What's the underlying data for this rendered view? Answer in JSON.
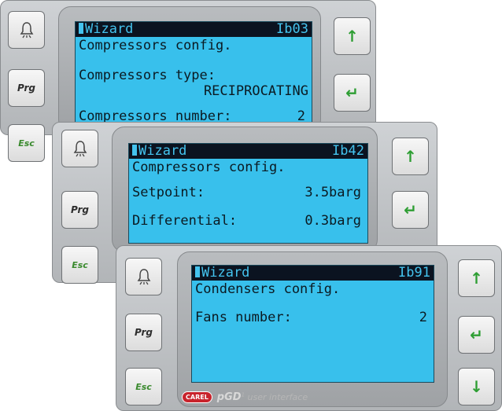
{
  "buttons": {
    "alarm_icon": "bell-icon",
    "prg": "Prg",
    "esc": "Esc",
    "up_icon": "up-arrow-icon",
    "enter_icon": "enter-icon",
    "down_icon": "down-arrow-icon"
  },
  "colors": {
    "lcd": "#38c0ec",
    "lcd_text": "#0b1a22",
    "header_bg": "#0b1320",
    "arrow": "#2e9e33",
    "esc": "#3a8a2e"
  },
  "panel1": {
    "header": "Wizard",
    "code": "Ib03",
    "title": "Compressors config.",
    "type_label": "Compressors type:",
    "type_value": "RECIPROCATING",
    "number_label": "Compressors number:",
    "number_value": "2"
  },
  "panel2": {
    "header": "Wizard",
    "code": "Ib42",
    "title": "Compressors config.",
    "setpoint_label": "Setpoint:",
    "setpoint_value": "3.5barg",
    "diff_label": "Differential:",
    "diff_value": "0.3barg"
  },
  "panel3": {
    "header": "Wizard",
    "code": "Ib91",
    "title": "Condensers config.",
    "fans_label": "Fans number:",
    "fans_value": "2",
    "brand_logo": "CAREL",
    "brand_name": "pGD",
    "brand_tagline": "user interface"
  }
}
